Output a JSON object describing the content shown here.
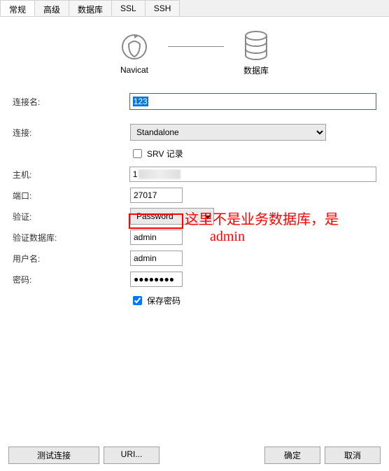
{
  "tabs": {
    "general": "常规",
    "advanced": "高级",
    "databases": "数据库",
    "ssl": "SSL",
    "ssh": "SSH"
  },
  "diagram": {
    "left_label": "Navicat",
    "right_label": "数据库"
  },
  "labels": {
    "conn_name": "连接名:",
    "connection": "连接:",
    "srv": "SRV 记录",
    "host": "主机:",
    "port": "端口:",
    "auth": "验证:",
    "auth_db": "验证数据库:",
    "username": "用户名:",
    "password": "密码:",
    "save_pw": "保存密码"
  },
  "values": {
    "conn_name": "123",
    "connection": "Standalone",
    "host_visible": "1",
    "port": "27017",
    "auth": "Password",
    "auth_db": "admin",
    "username": "admin",
    "password_mask": "●●●●●●●●",
    "srv_checked": false,
    "save_pw_checked": true
  },
  "footer": {
    "test": "测试连接",
    "uri": "URI...",
    "ok": "确定",
    "cancel": "取消"
  },
  "annotation": {
    "line1": "这里不是业务数据库，是",
    "line2": "admin"
  }
}
